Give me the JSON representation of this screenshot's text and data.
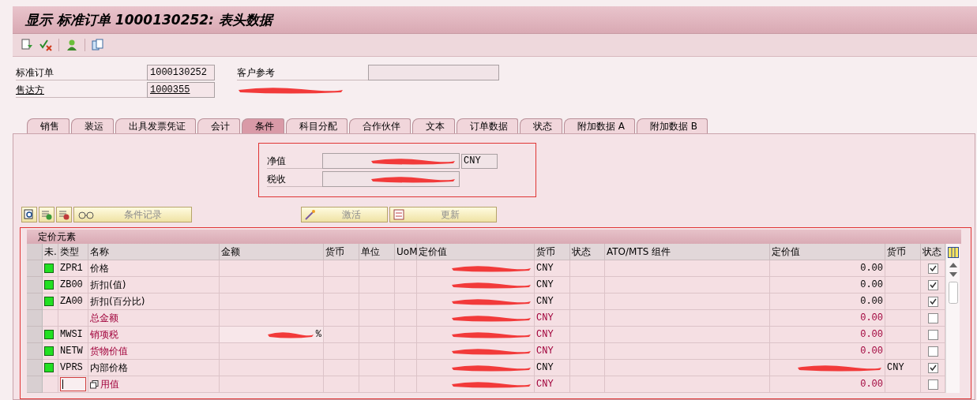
{
  "window": {
    "title": "显示 标准订单 1000130252: 表头数据"
  },
  "header": {
    "fields": [
      {
        "label": "标准订单",
        "value": "1000130252",
        "link": false
      },
      {
        "label": "售达方",
        "value": "1000355",
        "link": true
      }
    ],
    "customer_ref": {
      "label": "客户参考"
    },
    "sold_to_name_redacted": true
  },
  "tabs": [
    {
      "label": "销售",
      "selected": false
    },
    {
      "label": "装运",
      "selected": false
    },
    {
      "label": "出具发票凭证",
      "selected": false
    },
    {
      "label": "会计",
      "selected": false
    },
    {
      "label": "条件",
      "selected": true
    },
    {
      "label": "科目分配",
      "selected": false
    },
    {
      "label": "合作伙伴",
      "selected": false
    },
    {
      "label": "文本",
      "selected": false
    },
    {
      "label": "订单数据",
      "selected": false
    },
    {
      "label": "状态",
      "selected": false
    },
    {
      "label": "附加数据 A",
      "selected": false
    },
    {
      "label": "附加数据 B",
      "selected": false
    }
  ],
  "totals": [
    {
      "label": "净值",
      "currency": "CNY",
      "redacted": true
    },
    {
      "label": "税收",
      "redacted": true
    }
  ],
  "actions": [
    {
      "label": "条件记录",
      "disabled": true
    },
    {
      "label": "激活",
      "disabled": true
    },
    {
      "label": "更新",
      "disabled": true
    }
  ],
  "table": {
    "title": "定价元素",
    "columns": [
      "未.",
      "类型",
      "名称",
      "金额",
      "货币",
      "单位",
      "UoM",
      "定价值",
      "货币",
      "状态",
      "ATO/MTS 组件",
      "定价值",
      "货币",
      "状态"
    ],
    "rows": [
      {
        "active": true,
        "type": "ZPR1",
        "name": "价格",
        "amount_redacted": false,
        "unit_sign": "",
        "pricing_redacted": true,
        "currency": "CNY",
        "value2": "0.00",
        "value2_redacted": false,
        "currency2": "",
        "checked": true,
        "subtotal": false
      },
      {
        "active": true,
        "type": "ZB00",
        "name": "折扣(值)",
        "amount_redacted": false,
        "unit_sign": "",
        "pricing_redacted": true,
        "currency": "CNY",
        "value2": "0.00",
        "value2_redacted": false,
        "currency2": "",
        "checked": true,
        "subtotal": false
      },
      {
        "active": true,
        "type": "ZA00",
        "name": "折扣(百分比)",
        "amount_redacted": false,
        "unit_sign": "",
        "pricing_redacted": true,
        "currency": "CNY",
        "value2": "0.00",
        "value2_redacted": false,
        "currency2": "",
        "checked": true,
        "subtotal": false
      },
      {
        "active": false,
        "type": "",
        "name": "总金额",
        "amount_redacted": false,
        "unit_sign": "",
        "pricing_redacted": true,
        "currency": "CNY",
        "value2": "0.00",
        "value2_redacted": false,
        "currency2": "",
        "checked": false,
        "subtotal": true
      },
      {
        "active": true,
        "type": "MWSI",
        "name": "销项税",
        "amount_redacted": true,
        "unit_sign": "%",
        "pricing_redacted": true,
        "currency": "CNY",
        "value2": "0.00",
        "value2_redacted": false,
        "currency2": "",
        "checked": false,
        "subtotal": true
      },
      {
        "active": true,
        "type": "NETW",
        "name": "货物价值",
        "amount_redacted": false,
        "unit_sign": "",
        "pricing_redacted": true,
        "currency": "CNY",
        "value2": "0.00",
        "value2_redacted": false,
        "currency2": "",
        "checked": false,
        "subtotal": true
      },
      {
        "active": true,
        "type": "VPRS",
        "name": "内部价格",
        "amount_redacted": false,
        "unit_sign": "",
        "pricing_redacted": true,
        "currency": "CNY",
        "value2": "",
        "value2_redacted": true,
        "currency2": "CNY",
        "checked": true,
        "subtotal": false
      },
      {
        "active": false,
        "type": "",
        "name": "用值",
        "amount_redacted": false,
        "unit_sign": "",
        "pricing_redacted": true,
        "currency": "CNY",
        "value2": "0.00",
        "value2_redacted": false,
        "currency2": "",
        "checked": false,
        "subtotal": true,
        "editing": true
      }
    ]
  }
}
